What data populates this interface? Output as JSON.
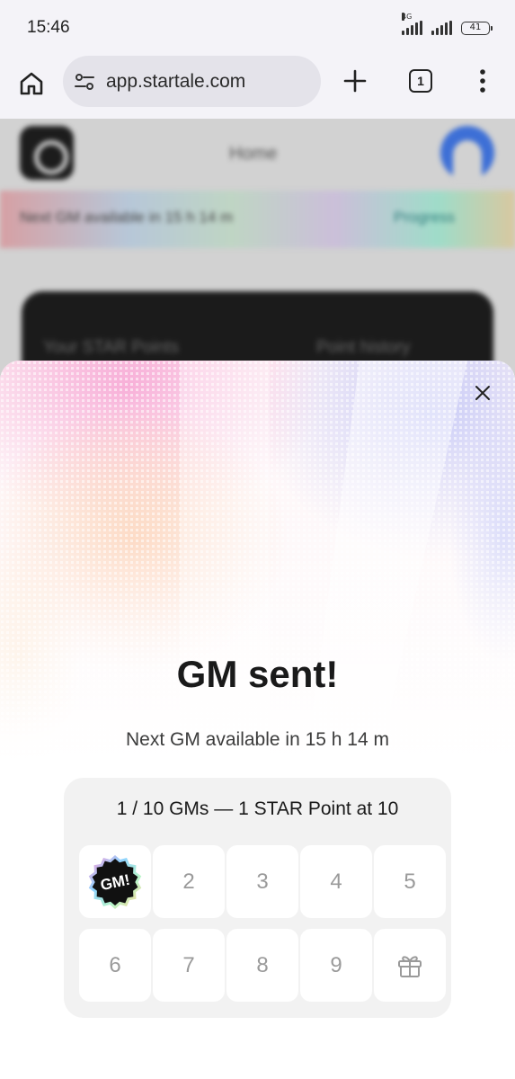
{
  "status_bar": {
    "time": "15:46",
    "network_label": "4G",
    "battery": "41"
  },
  "browser": {
    "url": "app.startale.com",
    "tab_count": "1"
  },
  "background_page": {
    "title": "Home",
    "banner_text": "Next GM available in 15 h 14 m",
    "banner_link": "Progress",
    "card_left": "Your STAR Points",
    "card_right": "Point history"
  },
  "modal": {
    "title": "GM sent!",
    "subtitle": "Next GM available in 15 h 14 m",
    "progress_heading": "1 / 10 GMs — 1 STAR Point at 10",
    "badge_text": "GM!",
    "completed_count": 1,
    "slots": [
      {
        "label": "GM!",
        "state": "done",
        "icon": "gm-badge-icon"
      },
      {
        "label": "2",
        "state": "pending"
      },
      {
        "label": "3",
        "state": "pending"
      },
      {
        "label": "4",
        "state": "pending"
      },
      {
        "label": "5",
        "state": "pending"
      },
      {
        "label": "6",
        "state": "pending"
      },
      {
        "label": "7",
        "state": "pending"
      },
      {
        "label": "8",
        "state": "pending"
      },
      {
        "label": "9",
        "state": "pending"
      },
      {
        "label": "",
        "state": "reward",
        "icon": "gift-icon"
      }
    ]
  },
  "colors": {
    "status_bg": "#f4f3f8",
    "url_pill": "#e4e3ea",
    "panel_bg": "#f2f2f2",
    "placeholder_number": "#9a9a9a",
    "art_pink": "#f6a6d8",
    "art_orange": "#fbb98f",
    "art_blue": "#c3c4f5"
  }
}
